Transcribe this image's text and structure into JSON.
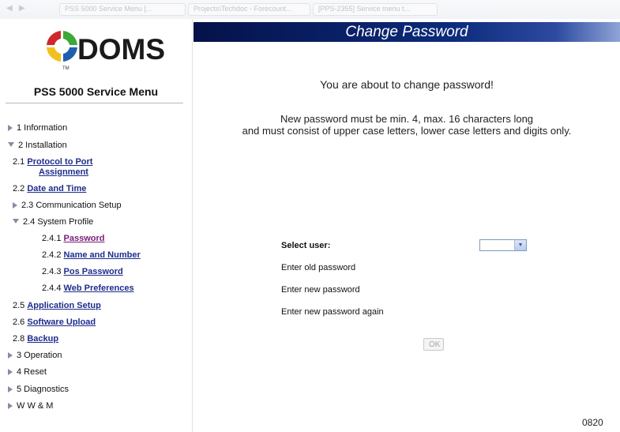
{
  "browser": {
    "tabs": [
      "PSS 5000 Service Menu [...",
      "Projects\\Techdoc - Forecount...",
      "[PPS-2355] Service menu t..."
    ]
  },
  "sidebar": {
    "logo_text": "DOMS",
    "logo_tm": "TM",
    "title": "PSS 5000 Service Menu",
    "items": [
      {
        "num": "",
        "label": "1 Information",
        "link": false
      },
      {
        "num": "",
        "label": "2 Installation",
        "link": false
      },
      {
        "num": "2.1",
        "label": "Protocol to Port",
        "label2": "Assignment",
        "link": true
      },
      {
        "num": "2.2",
        "label": "Date and Time",
        "link": true
      },
      {
        "num": "",
        "label": "2.3 Communication Setup",
        "link": false
      },
      {
        "num": "",
        "label": "2.4 System Profile",
        "link": false
      },
      {
        "num": "2.4.1",
        "label": "Password",
        "link": true
      },
      {
        "num": "2.4.2",
        "label": "Name and Number",
        "link": true
      },
      {
        "num": "2.4.3",
        "label": "Pos Password",
        "link": true
      },
      {
        "num": "2.4.4",
        "label": "Web Preferences",
        "link": true
      },
      {
        "num": "2.5",
        "label": "Application Setup",
        "link": true
      },
      {
        "num": "2.6",
        "label": "Software Upload",
        "link": true
      },
      {
        "num": "2.8",
        "label": "Backup",
        "link": true
      },
      {
        "num": "",
        "label": "3 Operation",
        "link": false
      },
      {
        "num": "",
        "label": "4 Reset",
        "link": false
      },
      {
        "num": "",
        "label": "5 Diagnostics",
        "link": false
      },
      {
        "num": "",
        "label": "W W & M",
        "link": false
      }
    ]
  },
  "main": {
    "title": "Change Password",
    "headline": "You are about to change password!",
    "rule_line1": "New password must be min. 4, max. 16 characters long",
    "rule_line2": "and must consist of upper case letters, lower case letters and digits only.",
    "select_user_label": "Select user:",
    "select_user_value": "",
    "old_password_label": "Enter old password",
    "new_password_label": "Enter new password",
    "new_password_again_label": "Enter new password again",
    "ok_label": "OK",
    "footer_code": "0820"
  },
  "colors": {
    "header_dark": "#05124a",
    "link": "#1d2d8c",
    "active_link": "#7a1a7a",
    "logo_red": "#d0262d",
    "logo_green": "#3aa935",
    "logo_blue": "#1f5fb0",
    "logo_yellow": "#f2c01e"
  }
}
